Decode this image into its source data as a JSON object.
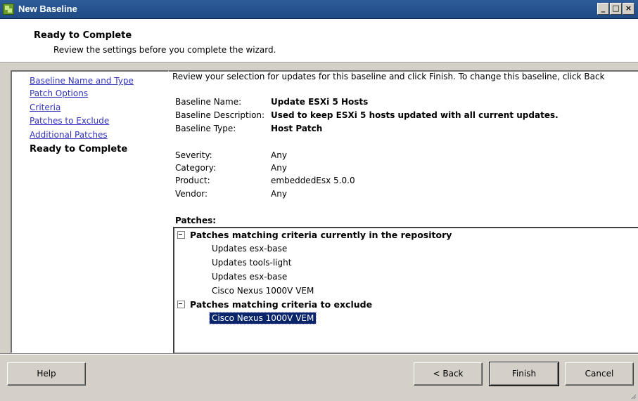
{
  "window": {
    "title": "New Baseline",
    "minimize_glyph": "_",
    "maximize_glyph": "□",
    "close_glyph": "×"
  },
  "header": {
    "title": "Ready to Complete",
    "subtitle": "Review the settings before you complete the wizard."
  },
  "nav": {
    "items": [
      {
        "label": "Baseline Name and Type"
      },
      {
        "label": "Patch Options"
      },
      {
        "label": "Criteria"
      },
      {
        "label": "Patches to Exclude"
      },
      {
        "label": "Additional Patches"
      },
      {
        "label": "Ready to Complete"
      }
    ]
  },
  "summary": {
    "intro": "Review your selection for updates for this baseline and click Finish. To change this baseline, click Back",
    "baseline_name_label": "Baseline Name:",
    "baseline_name": "Update ESXi 5 Hosts",
    "baseline_description_label": "Baseline Description:",
    "baseline_description": "Used to keep ESXi 5 hosts updated with all current updates.",
    "baseline_type_label": "Baseline Type:",
    "baseline_type": "Host Patch",
    "severity_label": "Severity:",
    "severity": "Any",
    "category_label": "Category:",
    "category": "Any",
    "product_label": "Product:",
    "product": "embeddedEsx 5.0.0",
    "vendor_label": "Vendor:",
    "vendor": "Any"
  },
  "patches": {
    "label": "Patches:",
    "groups": [
      {
        "label": "Patches matching criteria currently in the repository",
        "items": [
          "Updates esx-base",
          "Updates tools-light",
          "Updates esx-base",
          "Cisco Nexus 1000V VEM"
        ]
      },
      {
        "label": "Patches matching criteria to exclude",
        "items": [
          "Cisco Nexus 1000V VEM"
        ]
      }
    ]
  },
  "footer": {
    "help": "Help",
    "back": "< Back",
    "finish": "Finish",
    "cancel": "Cancel"
  },
  "colors": {
    "titlebar": "#1f4a86",
    "link": "#3333bb",
    "selection": "#0a246a",
    "dialog_bg": "#d4d0c8"
  }
}
